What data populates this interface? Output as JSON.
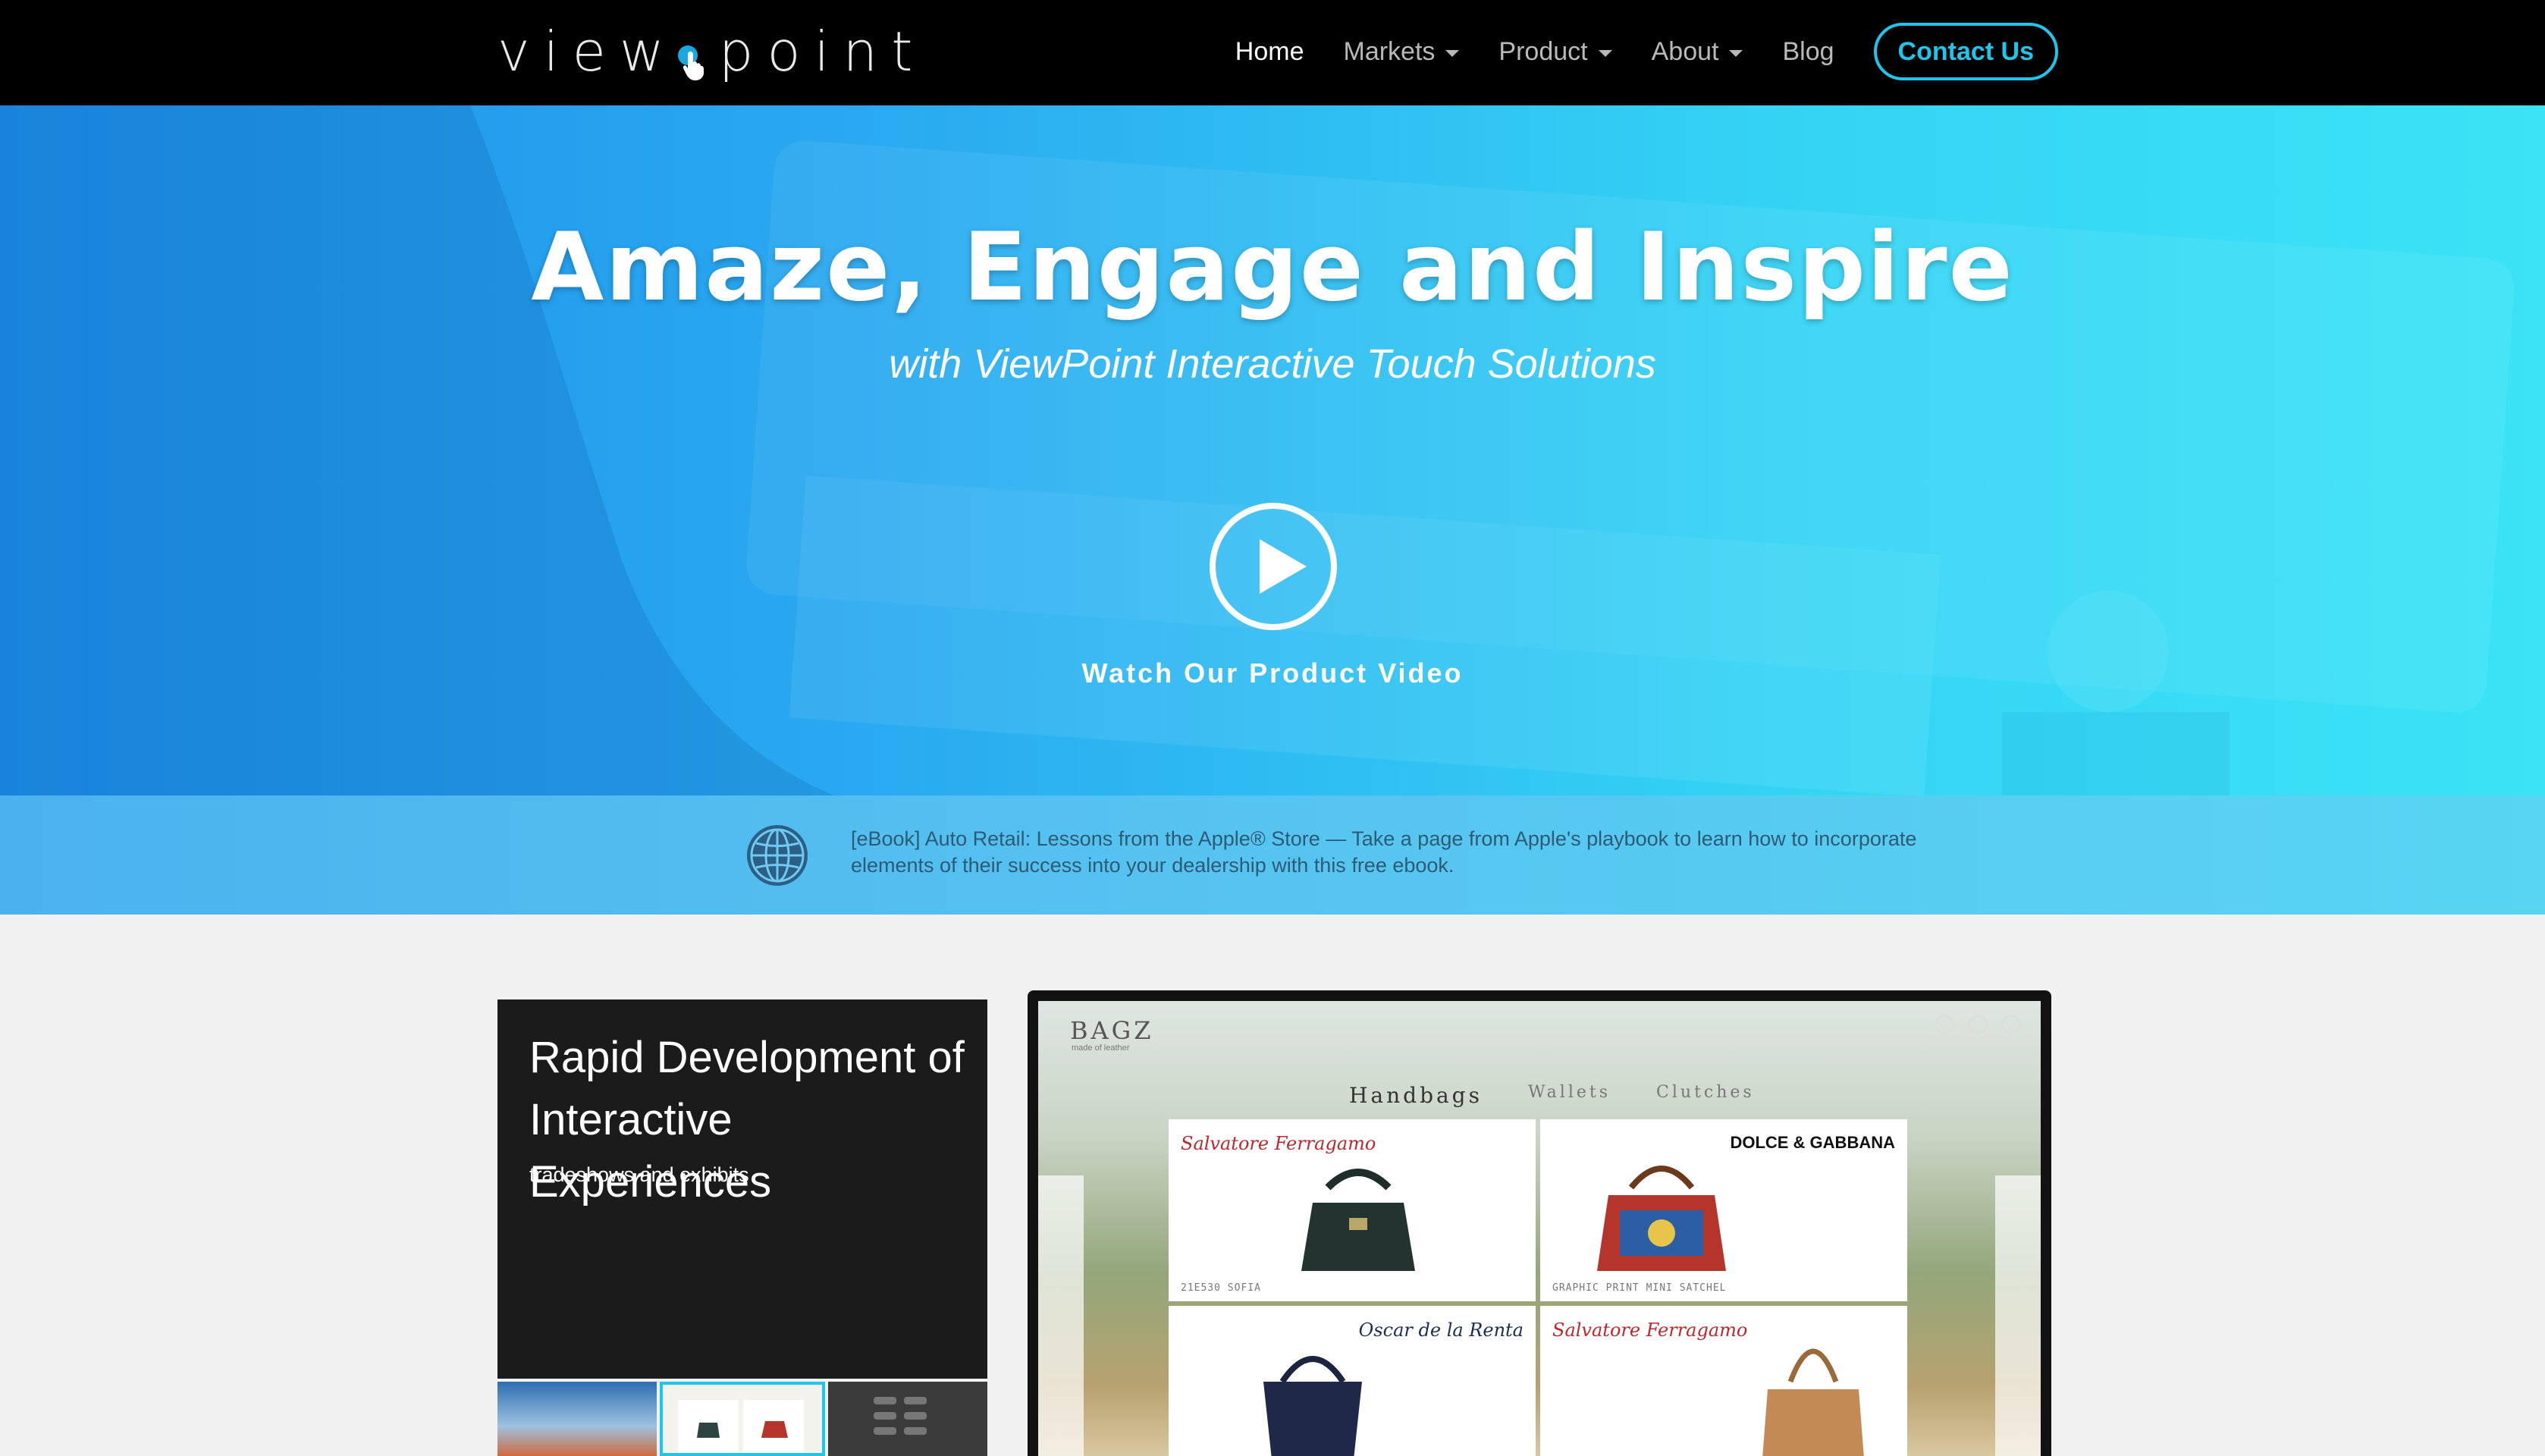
{
  "nav": {
    "logo_left": "view",
    "logo_right": "point",
    "items": [
      {
        "label": "Home",
        "active": true,
        "dropdown": false
      },
      {
        "label": "Markets",
        "active": false,
        "dropdown": true
      },
      {
        "label": "Product",
        "active": false,
        "dropdown": true
      },
      {
        "label": "About",
        "active": false,
        "dropdown": true
      },
      {
        "label": "Blog",
        "active": false,
        "dropdown": false
      }
    ],
    "contact_label": "Contact Us"
  },
  "hero": {
    "title": "Amaze, Engage and Inspire",
    "subtitle": "with ViewPoint Interactive Touch Solutions",
    "play_icon": "play-icon",
    "watch_label": "Watch Our Product Video"
  },
  "banner": {
    "icon": "globe-icon",
    "text": "[eBook] Auto Retail: Lessons from the Apple® Store — Take a page from Apple's playbook to learn how to incorporate elements of their success into your dealership with this free ebook."
  },
  "feature_card": {
    "title": "Rapid Development of Interactive Experiences",
    "subtitle": "tradeshows and exhibits"
  },
  "demo_screen": {
    "brand": "BAGZ",
    "brand_tag": "made of leather",
    "tabs": [
      "Handbags",
      "Wallets",
      "Clutches"
    ],
    "products": [
      {
        "maker": "Salvatore Ferragamo",
        "label": "21E530 SOFIA"
      },
      {
        "maker": "DOLCE & GABBANA",
        "label": "GRAPHIC PRINT MINI SATCHEL"
      },
      {
        "maker": "Oscar de la Renta",
        "label": ""
      },
      {
        "maker": "Salvatore Ferragamo",
        "label": ""
      }
    ]
  },
  "colors": {
    "accent": "#1ec6ec",
    "nav_bg": "#000000",
    "hero_left": "#1d8fea",
    "hero_right": "#3be3f6",
    "card_bg": "#1b1b1b",
    "page_bg": "#f1f1f1"
  }
}
